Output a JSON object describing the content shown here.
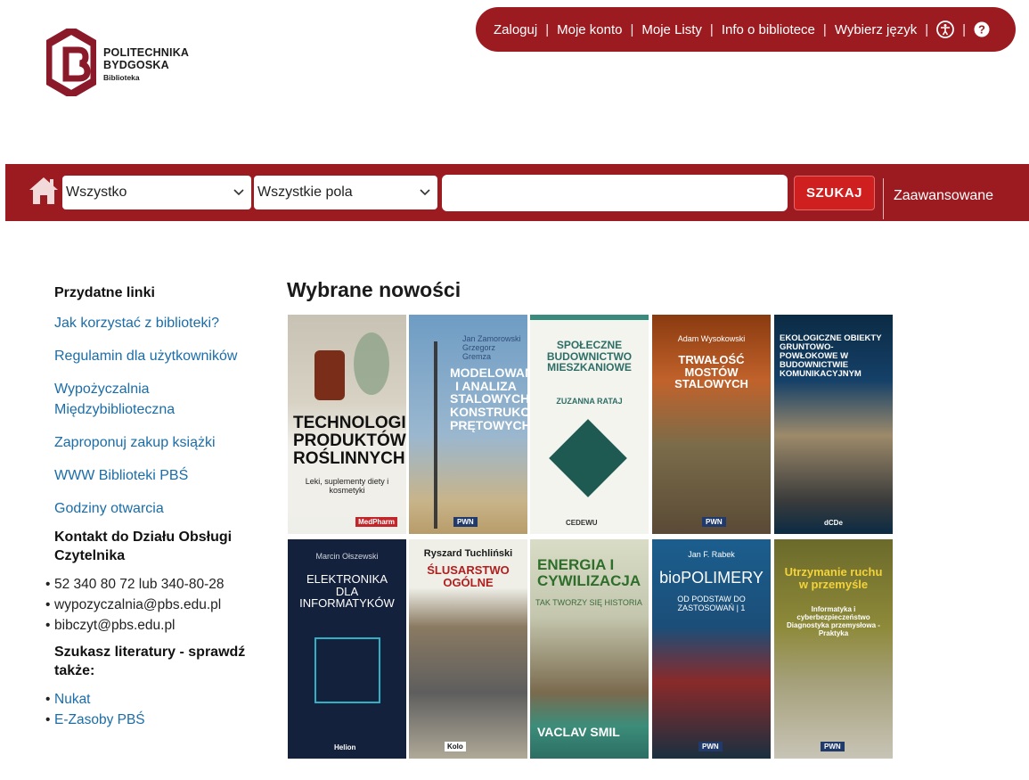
{
  "logo": {
    "line1": "POLITECHNIKA",
    "line2": "BYDGOSKA",
    "line3": "Biblioteka",
    "color": "#8a1a2a"
  },
  "topnav": {
    "items": [
      "Zaloguj",
      "Moje konto",
      "Moje Listy",
      "Info o bibliotece",
      "Wybierz język"
    ],
    "icons": [
      "accessibility-icon",
      "help-icon"
    ],
    "background": "#9c1b21"
  },
  "search": {
    "scope_value": "Wszystko",
    "field_value": "Wszystkie pola",
    "query": "",
    "button_label": "SZUKAJ",
    "advanced_label": "Zaawansowane"
  },
  "sidebar": {
    "useful_heading": "Przydatne linki",
    "links": [
      "Jak korzystać z biblioteki?",
      "Regulamin dla użytkowników",
      "Wypożyczalnia\nMiędzybiblioteczna",
      "Zaproponuj zakup książki",
      "WWW Biblioteki PBŚ",
      "Godziny otwarcia"
    ],
    "contact_heading": "Kontakt do Działu Obsługi Czytelnika",
    "contacts": [
      "52 340 80 72 lub 340-80-28",
      "wypozyczalnia@pbs.edu.pl",
      "bibczyt@pbs.edu.pl"
    ],
    "lit_heading": "Szukasz literatury - sprawdź także:",
    "lit_links": [
      "Nukat",
      "E-Zasoby PBŚ"
    ]
  },
  "main": {
    "title": "Wybrane nowości",
    "books": [
      {
        "title": "TECHNOLOGIA PRODUKTÓW ROŚLINNYCH",
        "author": "",
        "subtitle": "Leki, suplementy diety i kosmetyki",
        "publisher": "MedPharm"
      },
      {
        "title": "MODELOWANIE I ANALIZA STALOWYCH KONSTRUKCJI PRĘTOWYCH",
        "author": "Jan Zamorowski Grzegorz Gremza",
        "subtitle": "",
        "publisher": "PWN"
      },
      {
        "title": "SPOŁECZNE BUDOWNICTWO MIESZKANIOWE",
        "author": "",
        "subtitle": "ZUZANNA RATAJ",
        "publisher": "CEDEWU"
      },
      {
        "title": "TRWAŁOŚĆ MOSTÓW STALOWYCH",
        "author": "Adam Wysokowski",
        "subtitle": "",
        "publisher": "PWN"
      },
      {
        "title": "EKOLOGICZNE OBIEKTY GRUNTOWO-POWŁOKOWE W BUDOWNICTWIE KOMUNIKACYJNYM",
        "author": "",
        "subtitle": "",
        "publisher": "dCDe"
      },
      {
        "title": "ELEKTRONIKA DLA INFORMATYKÓW",
        "author": "Marcin Ołszewski",
        "subtitle": "",
        "publisher": "Helion"
      },
      {
        "title": "ŚLUSARSTWO OGÓLNE",
        "author": "Ryszard Tuchliński",
        "subtitle": "",
        "publisher": "Kolo"
      },
      {
        "title": "ENERGIA I CYWILIZACJA",
        "author": "",
        "subtitle": "TAK TWORZY SIĘ HISTORIA",
        "publisher": "VACLAV SMIL"
      },
      {
        "title": "bioPOLIMERY",
        "author": "Jan F. Rabek",
        "subtitle": "OD PODSTAW DO ZASTOSOWAŃ | 1",
        "publisher": "PWN"
      },
      {
        "title": "Utrzymanie ruchu w przemyśle",
        "author": "",
        "subtitle": "Informatyka i cyberbezpieczeństwo Diagnostyka przemysłowa - Praktyka",
        "publisher": "PWN"
      }
    ]
  }
}
